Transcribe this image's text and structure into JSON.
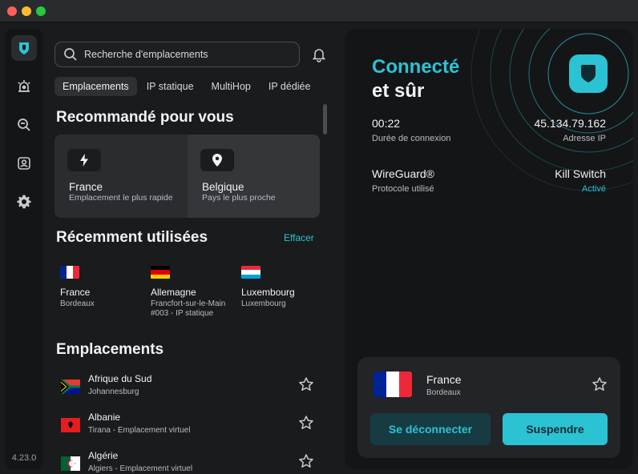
{
  "app": {
    "version": "4.23.0"
  },
  "search": {
    "placeholder": "Recherche d'emplacements"
  },
  "tabs": [
    {
      "label": "Emplacements",
      "active": true
    },
    {
      "label": "IP statique",
      "active": false
    },
    {
      "label": "MultiHop",
      "active": false
    },
    {
      "label": "IP dédiée",
      "active": false
    }
  ],
  "recommended": {
    "heading": "Recommandé pour vous",
    "cards": [
      {
        "icon": "lightning-icon",
        "title": "France",
        "subtitle": "Emplacement le plus rapide"
      },
      {
        "icon": "location-pin-icon",
        "title": "Belgique",
        "subtitle": "Pays le plus proche"
      }
    ]
  },
  "recent": {
    "heading": "Récemment utilisées",
    "clear_label": "Effacer",
    "items": [
      {
        "name": "France",
        "sub": "Bordeaux",
        "flag": [
          "#002395",
          "#ffffff",
          "#ed2939"
        ]
      },
      {
        "name": "Allemagne",
        "sub": "Francfort-sur-le-Main #003 - IP statique",
        "flag": [
          "#000000",
          "#dd0000",
          "#ffce00"
        ]
      },
      {
        "name": "Luxembourg",
        "sub": "Luxembourg",
        "flag": [
          "#ed2939",
          "#ffffff",
          "#00a1de"
        ]
      }
    ]
  },
  "locations": {
    "heading": "Emplacements",
    "items": [
      {
        "name": "Afrique du Sud",
        "sub": "Johannesburg"
      },
      {
        "name": "Albanie",
        "sub": "Tirana - Emplacement virtuel"
      },
      {
        "name": "Algérie",
        "sub": "Algiers - Emplacement virtuel"
      }
    ]
  },
  "status": {
    "line1": "Connecté",
    "line2": "et sûr",
    "duration_value": "00:22",
    "duration_label": "Durée de connexion",
    "ip_value": "45.134.79.162",
    "ip_label": "Adresse IP",
    "protocol_value": "WireGuard®",
    "protocol_label": "Protocole utilisé",
    "killswitch_value": "Kill Switch",
    "killswitch_state": "Activé"
  },
  "connection": {
    "country": "France",
    "city": "Bordeaux",
    "disconnect_label": "Se déconnecter",
    "pause_label": "Suspendre"
  },
  "colors": {
    "accent": "#2bc3d4",
    "background": "#1a1b1d",
    "panel": "#141517"
  }
}
